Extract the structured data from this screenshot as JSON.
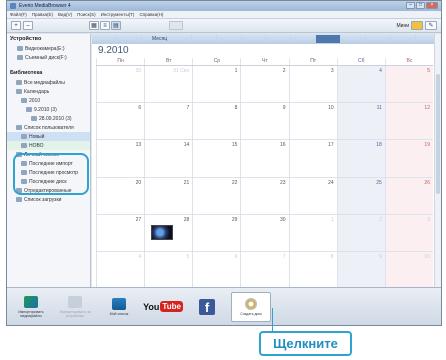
{
  "window": {
    "title": "Everio MediaBrowser 4"
  },
  "menu": [
    "Файл(F)",
    "Правка(E)",
    "Вид(V)",
    "Поиск(S)",
    "Инструменты(T)",
    "Справка(H)"
  ],
  "toolbar": {
    "view_label": "Месяц",
    "display_label": "Мини"
  },
  "sidebar": {
    "devices_header": "Устройство",
    "devices": [
      "Видеокамера(E:)",
      "Съемный диск(F:)"
    ],
    "library_header": "Библиотека",
    "library": [
      {
        "label": "Все медиафайлы",
        "level": 1
      },
      {
        "label": "Календарь",
        "level": 1
      },
      {
        "label": "2010",
        "level": 2
      },
      {
        "label": "9.2010 (3)",
        "level": 3
      },
      {
        "label": "28.09.2010 (3)",
        "level": 4
      },
      {
        "label": "Список пользователя",
        "level": 1
      },
      {
        "label": "Новый",
        "level": 2,
        "selected": true
      },
      {
        "label": "НОВО",
        "level": 2,
        "selected2": true
      },
      {
        "label": "Личный список",
        "level": 1
      },
      {
        "label": "Последние импорт",
        "level": 2
      },
      {
        "label": "Последние просмотр",
        "level": 2
      },
      {
        "label": "Последние диск",
        "level": 2
      },
      {
        "label": "Отредактированные",
        "level": 1
      },
      {
        "label": "Список загрузки",
        "level": 1
      }
    ]
  },
  "calendar": {
    "month_title": "9.2010",
    "month_bar": [
      "",
      "",
      "",
      "",
      "",
      "",
      "",
      "",
      "",
      "",
      "",
      "",
      "",
      ""
    ],
    "day_headers": [
      "Пн",
      "Вт",
      "Ср",
      "Чт",
      "Пт",
      "Сб",
      "Вс"
    ],
    "weeks": [
      [
        {
          "d": "30",
          "o": true
        },
        {
          "d": "31 Сен",
          "o": true
        },
        {
          "d": "1"
        },
        {
          "d": "2"
        },
        {
          "d": "3"
        },
        {
          "d": "4"
        },
        {
          "d": "5"
        }
      ],
      [
        {
          "d": "6"
        },
        {
          "d": "7"
        },
        {
          "d": "8"
        },
        {
          "d": "9"
        },
        {
          "d": "10"
        },
        {
          "d": "11"
        },
        {
          "d": "12"
        }
      ],
      [
        {
          "d": "13"
        },
        {
          "d": "14"
        },
        {
          "d": "15"
        },
        {
          "d": "16"
        },
        {
          "d": "17"
        },
        {
          "d": "18"
        },
        {
          "d": "19"
        }
      ],
      [
        {
          "d": "20"
        },
        {
          "d": "21"
        },
        {
          "d": "22"
        },
        {
          "d": "23"
        },
        {
          "d": "24"
        },
        {
          "d": "25"
        },
        {
          "d": "26"
        }
      ],
      [
        {
          "d": "27"
        },
        {
          "d": "28",
          "thumb": true
        },
        {
          "d": "29"
        },
        {
          "d": "30"
        },
        {
          "d": "1",
          "o": true
        },
        {
          "d": "2",
          "o": true
        },
        {
          "d": "3",
          "o": true
        }
      ],
      [
        {
          "d": "4",
          "o": true
        },
        {
          "d": "5",
          "o": true
        },
        {
          "d": "6",
          "o": true
        },
        {
          "d": "7",
          "o": true
        },
        {
          "d": "8",
          "o": true
        },
        {
          "d": "9",
          "o": true
        },
        {
          "d": "10",
          "o": true
        }
      ]
    ]
  },
  "bottom": {
    "import_label": "Импортировать медиафайлы",
    "export_label": "Экспортировать на устройство",
    "library_label": "Мой список",
    "youtube_text": "You",
    "youtube_tube": "Tube",
    "facebook_text": "f",
    "disc_label": "Создать диск"
  },
  "callout_text": "Щелкните"
}
